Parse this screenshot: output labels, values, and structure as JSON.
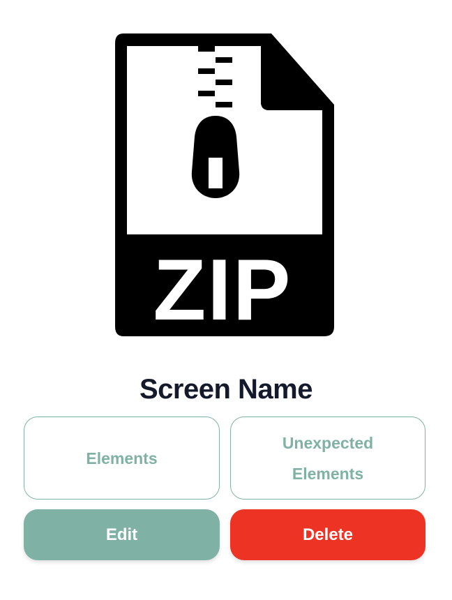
{
  "file_icon": {
    "label": "ZIP",
    "icon_name": "zip-file-icon"
  },
  "screen": {
    "name": "Screen Name"
  },
  "buttons": {
    "elements_label": "Elements",
    "unexpected_elements_label": "Unexpected Elements",
    "edit_label": "Edit",
    "delete_label": "Delete"
  },
  "colors": {
    "accent": "#7fb1a5",
    "danger": "#ed3424",
    "title_text": "#141a2b"
  }
}
